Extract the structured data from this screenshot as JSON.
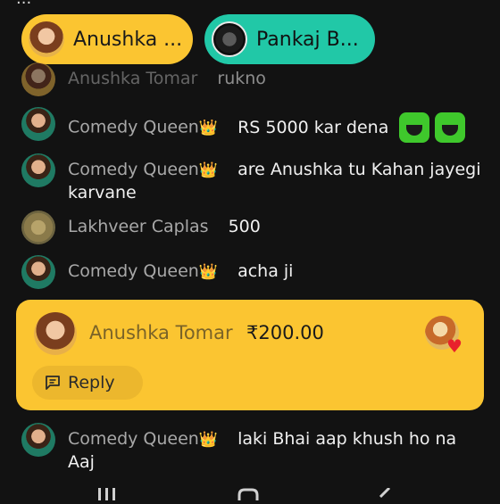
{
  "top_partial_text": "...",
  "pills": [
    {
      "name": "Anushka ...",
      "avatar": "user-avatar"
    },
    {
      "name": "Pankaj B...",
      "avatar": "user-avatar"
    }
  ],
  "chat": [
    {
      "user": "Anushka Tomar",
      "crown": "",
      "text": "rukno"
    },
    {
      "user": "Comedy Queen",
      "crown": "👑",
      "text": "RS 5000 kar dena"
    },
    {
      "user": "Comedy Queen",
      "crown": "👑",
      "text": "are Anushka tu Kahan jayegi karvane"
    },
    {
      "user": "Lakhveer Caplas",
      "crown": "",
      "text": "500"
    },
    {
      "user": "Comedy Queen",
      "crown": "👑",
      "text": "acha ji"
    },
    {
      "user": "Comedy Queen",
      "crown": "👑",
      "text": "laki Bhai aap khush ho na Aaj"
    }
  ],
  "tip": {
    "user": "Anushka Tomar",
    "amount": "₹200.00",
    "reply_label": "Reply",
    "reaction_icon": "heart-icon"
  },
  "colors": {
    "background": "#121212",
    "pill_yellow": "#fbc531",
    "pill_teal": "#21c8a7",
    "username_gray": "#a8a8a8",
    "heart_red": "#e8222c"
  },
  "nav": {
    "icons": [
      "recent-apps-icon",
      "home-icon",
      "back-icon"
    ]
  }
}
